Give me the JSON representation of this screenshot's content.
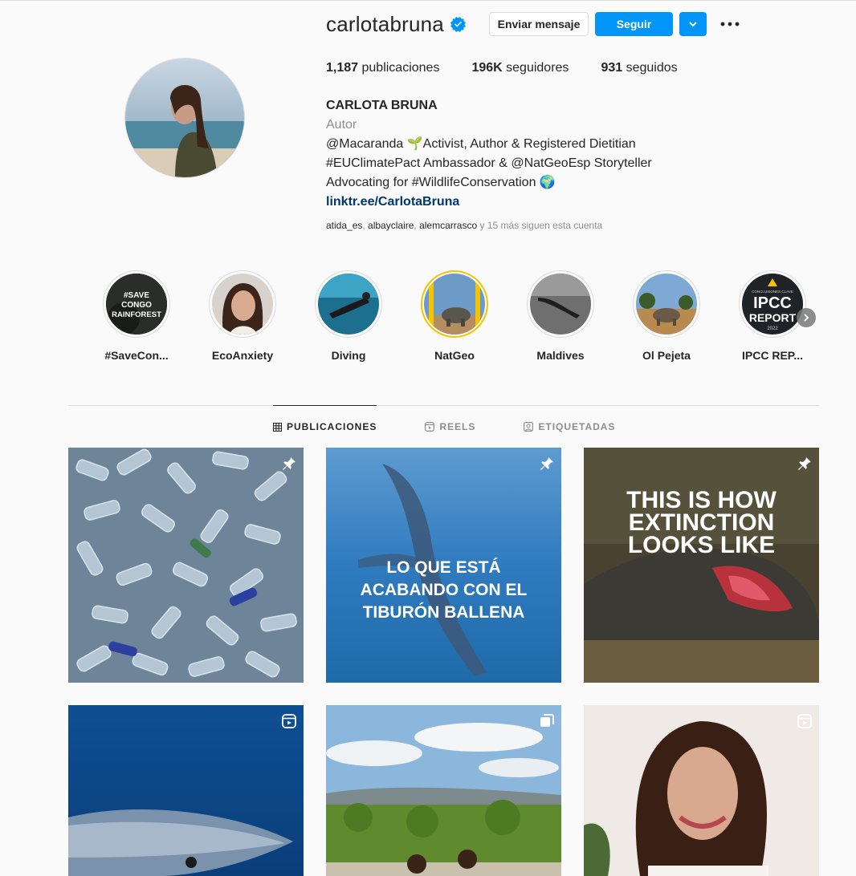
{
  "profile": {
    "username": "carlotabruna",
    "message_label": "Enviar mensaje",
    "follow_label": "Seguir"
  },
  "stats": {
    "posts_value": "1,187",
    "posts_label": "publicaciones",
    "followers_value": "196K",
    "followers_label": "seguidores",
    "following_value": "931",
    "following_label": "seguidos"
  },
  "bio": {
    "name": "CARLOTA BRUNA",
    "category": "Autor",
    "line1": "@Macaranda 🌱Activist, Author & Registered Dietitian",
    "line2": "#EUClimatePact Ambassador & @NatGeoEsp Storyteller",
    "line3": "Advocating for #WildlifeConservation 🌍",
    "link": "linktr.ee/CarlotaBruna"
  },
  "followed_by": {
    "user1": "atida_es",
    "user2": "albayclaire",
    "user3": "alemcarrasco",
    "rest": "y 15 más siguen esta cuenta"
  },
  "highlights": [
    {
      "label": "#SaveCon...",
      "cover_text": "#SAVE CONGO RAINFOREST"
    },
    {
      "label": "EcoAnxiety"
    },
    {
      "label": "Diving"
    },
    {
      "label": "NatGeo"
    },
    {
      "label": "Maldives"
    },
    {
      "label": "Ol Pejeta"
    },
    {
      "label": "IPCC REP...",
      "cover_top": "CONCLUSIONES CLAVE",
      "cover_text": "IPCC REPORT",
      "cover_year": "2022"
    }
  ],
  "tabs": [
    {
      "label": "PUBLICACIONES",
      "icon": "grid-icon",
      "active": true
    },
    {
      "label": "REELS",
      "icon": "reels-icon",
      "active": false
    },
    {
      "label": "ETIQUETADAS",
      "icon": "tagged-icon",
      "active": false
    }
  ],
  "posts": [
    {
      "icon": "pin-icon"
    },
    {
      "icon": "pin-icon",
      "text": "LO QUE ESTÁ ACABANDO CON EL TIBURÓN BALLENA"
    },
    {
      "icon": "pin-icon",
      "text": "THIS IS HOW EXTINCTION LOOKS LIKE"
    },
    {
      "icon": "reel-icon"
    },
    {
      "icon": "carousel-icon"
    },
    {
      "icon": "reel-icon"
    }
  ],
  "colors": {
    "accent": "#0095f6",
    "link": "#00376b",
    "muted": "#8e8e8e",
    "text": "#262626"
  }
}
